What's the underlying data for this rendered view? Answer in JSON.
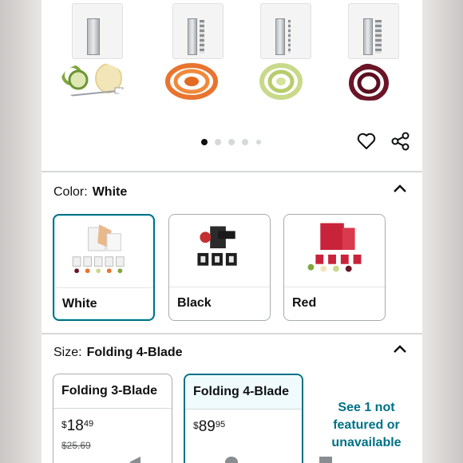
{
  "product_gallery": {
    "images": [
      {
        "icon": "spiralizer-ribbon-blade-image",
        "veg_color": "#7fa63c",
        "veg_color2": "#f2e6b8"
      },
      {
        "icon": "spiralizer-shredder-blade-image",
        "veg_color": "#e8742f"
      },
      {
        "icon": "spiralizer-fine-blade-image",
        "veg_color": "#c9d98a"
      },
      {
        "icon": "spiralizer-chipper-blade-image",
        "veg_color": "#6b1628"
      }
    ],
    "carousel": {
      "count": 5,
      "active_index": 0
    }
  },
  "actions": {
    "favorite_icon": "heart-icon",
    "share_icon": "share-icon"
  },
  "color_section": {
    "label": "Color:",
    "value": "White",
    "options": [
      {
        "name": "White",
        "selected": true
      },
      {
        "name": "Black",
        "selected": false
      },
      {
        "name": "Red",
        "selected": false
      }
    ]
  },
  "size_section": {
    "label": "Size:",
    "value": "Folding 4-Blade",
    "options": [
      {
        "name": "Folding 3-Blade",
        "currency": "$",
        "price_whole": "18",
        "price_fraction": "49",
        "list_price": "$25.69",
        "selected": false
      },
      {
        "name": "Folding 4-Blade",
        "currency": "$",
        "price_whole": "89",
        "price_fraction": "95",
        "selected": true
      }
    ],
    "see_more": "See 1 not featured or unavailable"
  },
  "colors": {
    "accent": "#007185",
    "text": "#0f1111",
    "border": "#d5d9d9"
  }
}
